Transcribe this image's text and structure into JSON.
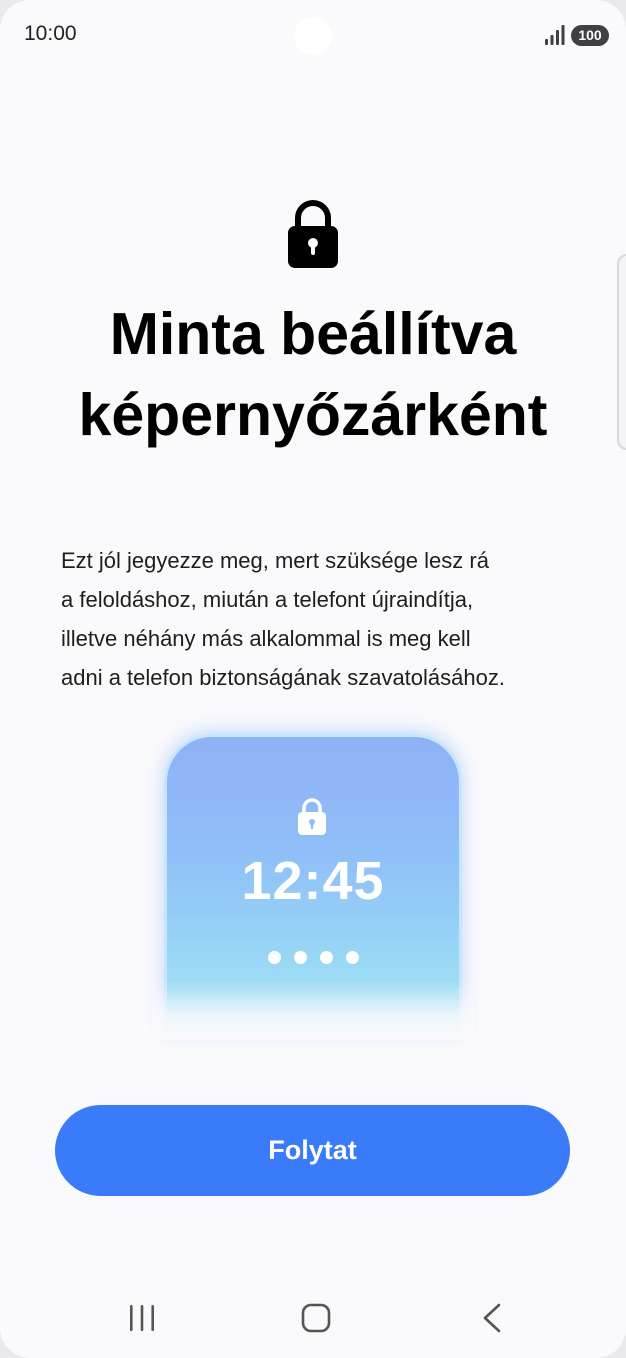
{
  "status_bar": {
    "time": "10:00",
    "battery": "100",
    "icons": [
      "signal-icon",
      "battery-icon"
    ]
  },
  "header": {
    "icon": "lock-icon",
    "title_line1": "Minta beállítva",
    "title_line2": "képernyőzárként"
  },
  "description": {
    "lines": [
      "Ezt jól jegyezze meg, mert szüksége lesz rá",
      "a feloldáshoz, miután a telefont újraindítja,",
      "illetve néhány más alkalommal is meg kell",
      "adni a telefon biztonságának szavatolásához."
    ]
  },
  "illustration": {
    "clock": "12:45",
    "icon": "lock-icon",
    "dots_count": 4
  },
  "actions": {
    "continue_label": "Folytat"
  },
  "nav_bar": {
    "icons": [
      "recent-apps-icon",
      "home-icon",
      "back-icon"
    ]
  },
  "colors": {
    "accent": "#3a7bfa",
    "background": "#fafafc",
    "illustration_top": "#8fb1f6",
    "illustration_bottom": "#a9e3f4"
  }
}
